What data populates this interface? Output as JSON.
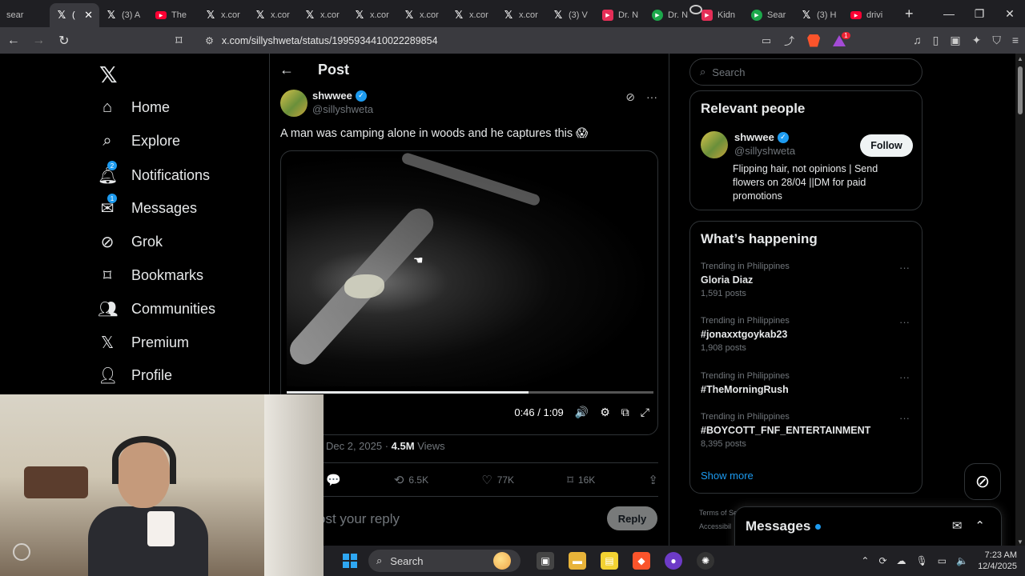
{
  "browser": {
    "tabs": [
      {
        "label": "sear",
        "icon": "search-icon",
        "active": false
      },
      {
        "label": "(",
        "icon": "x-logo-icon",
        "active": true
      },
      {
        "label": "(3) A",
        "icon": "x-logo-icon"
      },
      {
        "label": "The",
        "icon": "youtube-icon"
      },
      {
        "label": "x.cor",
        "icon": "x-logo-icon"
      },
      {
        "label": "x.cor",
        "icon": "x-logo-icon"
      },
      {
        "label": "x.cor",
        "icon": "x-logo-icon"
      },
      {
        "label": "x.cor",
        "icon": "x-logo-icon"
      },
      {
        "label": "x.cor",
        "icon": "x-logo-icon"
      },
      {
        "label": "x.cor",
        "icon": "x-logo-icon"
      },
      {
        "label": "x.cor",
        "icon": "x-logo-icon"
      },
      {
        "label": "(3) V",
        "icon": "x-logo-icon"
      },
      {
        "label": "Dr. N",
        "icon": "red-app-icon"
      },
      {
        "label": "Dr. N",
        "icon": "green-play-icon"
      },
      {
        "label": "Kidn",
        "icon": "red-app-icon"
      },
      {
        "label": "Sear",
        "icon": "green-play-icon"
      },
      {
        "label": "(3) H",
        "icon": "x-logo-icon"
      },
      {
        "label": "drivi",
        "icon": "youtube-icon"
      }
    ],
    "url": "x.com/sillyshweta/status/1995934410022289854"
  },
  "nav": {
    "items": [
      {
        "label": "Home",
        "icon": "home-icon"
      },
      {
        "label": "Explore",
        "icon": "search-icon"
      },
      {
        "label": "Notifications",
        "icon": "bell-icon",
        "badge": "2"
      },
      {
        "label": "Messages",
        "icon": "envelope-icon",
        "badge": "1"
      },
      {
        "label": "Grok",
        "icon": "grok-icon"
      },
      {
        "label": "Bookmarks",
        "icon": "bookmark-icon"
      },
      {
        "label": "Communities",
        "icon": "communities-icon"
      },
      {
        "label": "Premium",
        "icon": "x-logo-icon"
      },
      {
        "label": "Profile",
        "icon": "person-icon"
      }
    ]
  },
  "post": {
    "header_title": "Post",
    "display_name": "shwwee",
    "handle": "@sillyshweta",
    "text": "A man was camping alone in woods and he captures this 😱",
    "video_time": "0:46 / 1:09",
    "video_progress_fraction": 0.66,
    "date": "Dec 2, 2025",
    "views_count": "4.5M",
    "views_label": "Views",
    "retweets": "6.5K",
    "likes": "77K",
    "bookmarks": "16K",
    "reply_placeholder": "ost your reply",
    "reply_button": "Reply"
  },
  "sidebar": {
    "search_placeholder": "Search",
    "relevant_title": "Relevant people",
    "relevant_person": {
      "name": "shwwee",
      "handle": "@sillyshweta",
      "bio": "Flipping hair, not opinions | Send flowers on 28/04 ||DM for paid promotions",
      "follow_label": "Follow"
    },
    "happening_title": "What’s happening",
    "trends": [
      {
        "context": "Trending in Philippines",
        "title": "Gloria Diaz",
        "posts": "1,591 posts"
      },
      {
        "context": "Trending in Philippines",
        "title": "#jonaxxtgoykab23",
        "posts": "1,908 posts"
      },
      {
        "context": "Trending in Philippines",
        "title": "#TheMorningRush",
        "posts": ""
      },
      {
        "context": "Trending in Philippines",
        "title": "#BOYCOTT_FNF_ENTERTAINMENT",
        "posts": "8,395 posts"
      }
    ],
    "show_more": "Show more",
    "terms_line1": "Terms of Se",
    "terms_line2": "Accessibil"
  },
  "messages_drawer": {
    "title": "Messages"
  },
  "taskbar": {
    "search_label": "Search",
    "time": "7:23 AM",
    "date": "12/4/2025"
  },
  "colors": {
    "accent": "#1d9bf0",
    "background": "#000000",
    "border": "#2f3336"
  }
}
